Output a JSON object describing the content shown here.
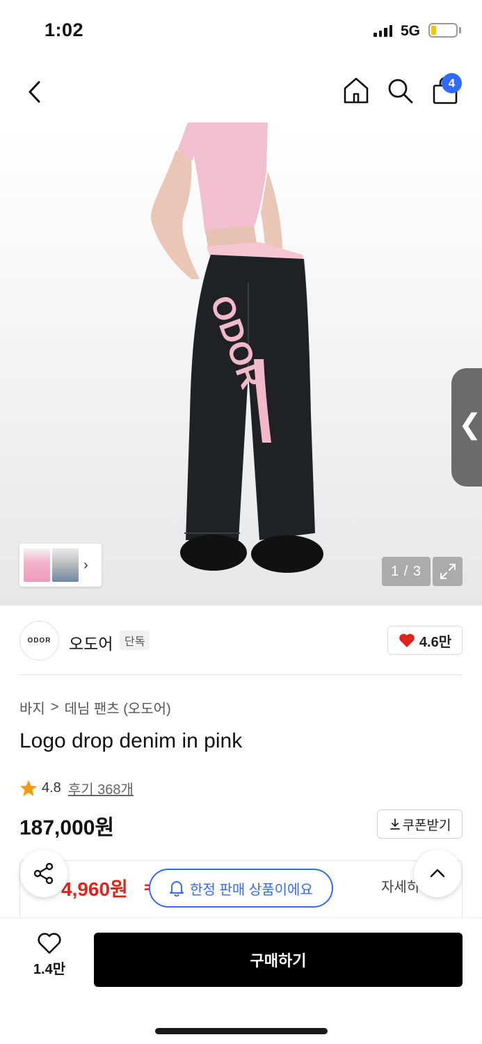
{
  "status_bar": {
    "time": "1:02",
    "network": "5G",
    "battery_level": 0.2,
    "battery_color": "#f5c400"
  },
  "nav": {
    "cart_count": "4",
    "back_icon": "chevron-left-icon",
    "home_icon": "home-icon",
    "search_icon": "search-icon",
    "cart_icon": "bag-icon",
    "accent": "#2f6bff"
  },
  "gallery": {
    "page_counter": "1 / 3",
    "thumbnail_chevron": "›",
    "side_tab_arrow": "❮",
    "logo_print": "ODOR",
    "expand_icon": "expand-icon"
  },
  "brand": {
    "logo_text": "ODOR",
    "name": "오도어",
    "badge": "단독",
    "like_count": "4.6만",
    "like_icon": "heart-icon",
    "heart_color": "#e0241b"
  },
  "product": {
    "breadcrumb": [
      "바지",
      "데님 팬츠 (오도어)"
    ],
    "breadcrumb_separator": ">",
    "title": "Logo drop denim in pink",
    "rating": "4.8",
    "review_text": "후기 368개",
    "star_color": "#f59a0f",
    "price": "187,000원",
    "coupon_label": "쿠폰받기"
  },
  "benefit": {
    "sale_price": "4,960원",
    "sale_suffix": "ㅋ",
    "detail_label": "자세히",
    "sale_color": "#e0241b"
  },
  "toast": {
    "text": "한정 판매 상품이에요",
    "icon": "bell-icon"
  },
  "bottom_bar": {
    "wish_count": "1.4만",
    "buy_label": "구매하기"
  }
}
